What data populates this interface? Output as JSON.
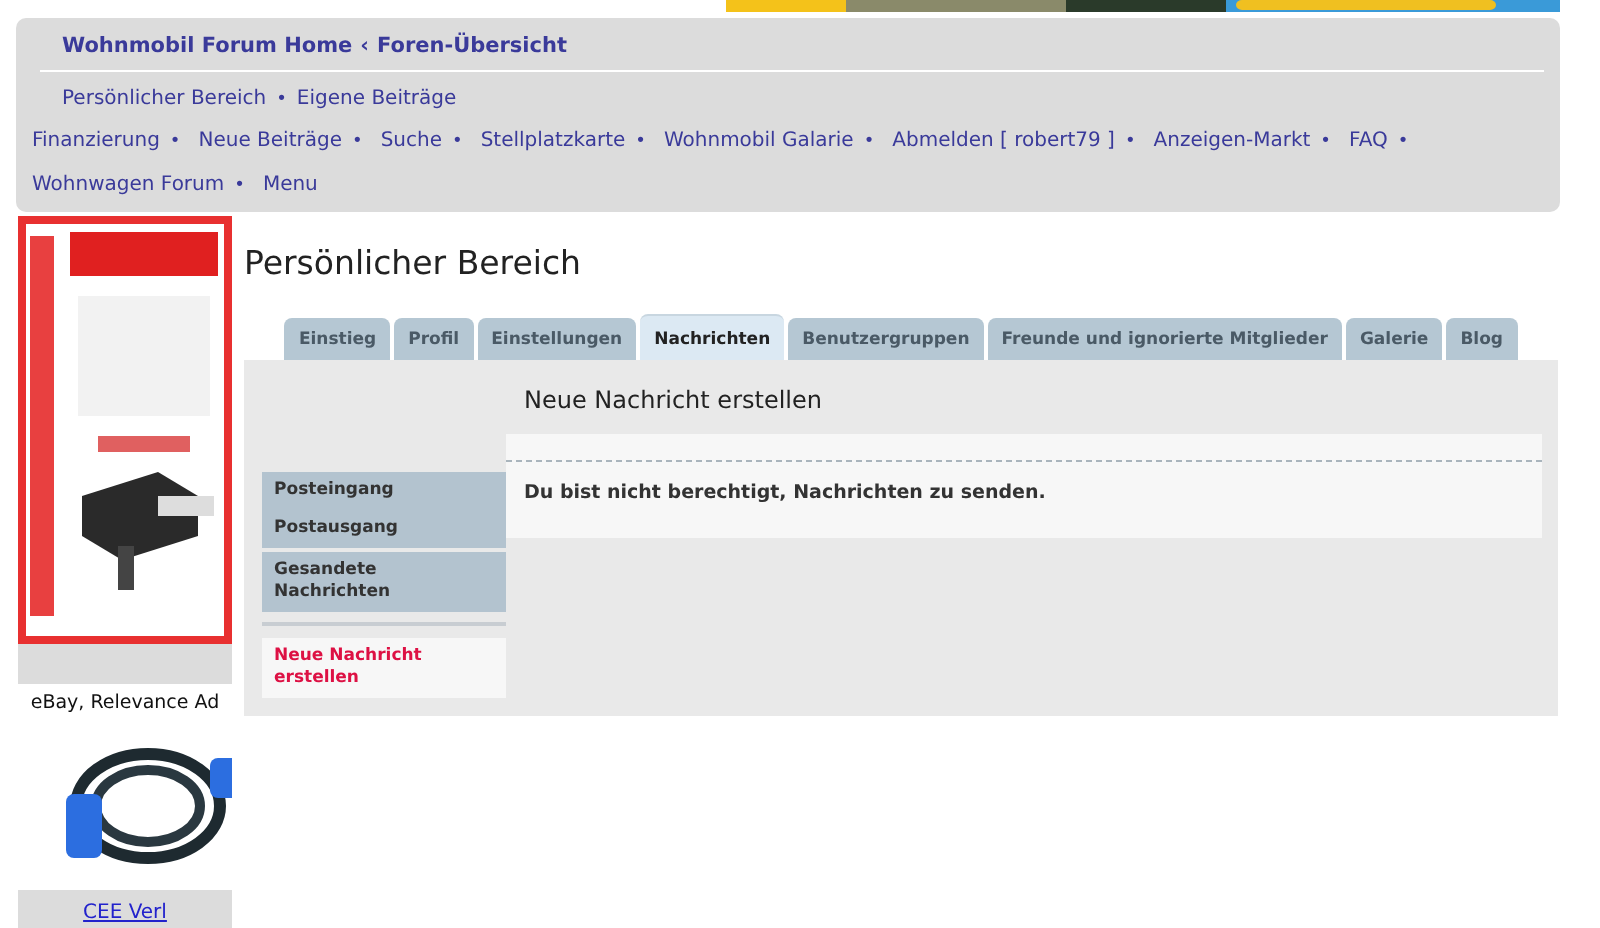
{
  "breadcrumb": [
    {
      "label": "Wohnmobil Forum Home"
    },
    {
      "label": "Foren-Übersicht"
    }
  ],
  "breadcrumb_separator": "‹",
  "bullet": "•",
  "sub_links": [
    {
      "label": "Persönlicher Bereich"
    },
    {
      "label": "Eigene Beiträge"
    }
  ],
  "nav_links": [
    {
      "label": "Finanzierung"
    },
    {
      "label": "Neue Beiträge"
    },
    {
      "label": "Suche"
    },
    {
      "label": "Stellplatzkarte"
    },
    {
      "label": "Wohnmobil Galarie"
    },
    {
      "label": "Abmelden [ robert79 ]"
    },
    {
      "label": "Anzeigen-Markt"
    },
    {
      "label": "FAQ"
    },
    {
      "label": "Wohnwagen Forum"
    },
    {
      "label": "Menu"
    }
  ],
  "sidebar": {
    "ad_label": "eBay, Relevance Ad",
    "ad_link": "CEE Verl"
  },
  "page_title": "Persönlicher Bereich",
  "tabs": [
    {
      "label": "Einstieg",
      "selected": false
    },
    {
      "label": "Profil",
      "selected": false
    },
    {
      "label": "Einstellungen",
      "selected": false
    },
    {
      "label": "Nachrichten",
      "selected": true
    },
    {
      "label": "Benutzergruppen",
      "selected": false
    },
    {
      "label": "Freunde und ignorierte Mitglieder",
      "selected": false
    },
    {
      "label": "Galerie",
      "selected": false
    },
    {
      "label": "Blog",
      "selected": false
    }
  ],
  "menu_groups": [
    {
      "items": [
        {
          "label": "Posteingang",
          "selected": false
        },
        {
          "label": "Postausgang",
          "selected": false
        }
      ]
    },
    {
      "items": [
        {
          "label": "Gesandete Nachrichten",
          "selected": false
        }
      ]
    },
    {
      "items": [
        {
          "label": "Neue Nachricht erstellen",
          "selected": true
        }
      ]
    }
  ],
  "content": {
    "heading": "Neue Nachricht erstellen",
    "message": "Du bist nicht berechtigt, Nachrichten zu senden."
  }
}
